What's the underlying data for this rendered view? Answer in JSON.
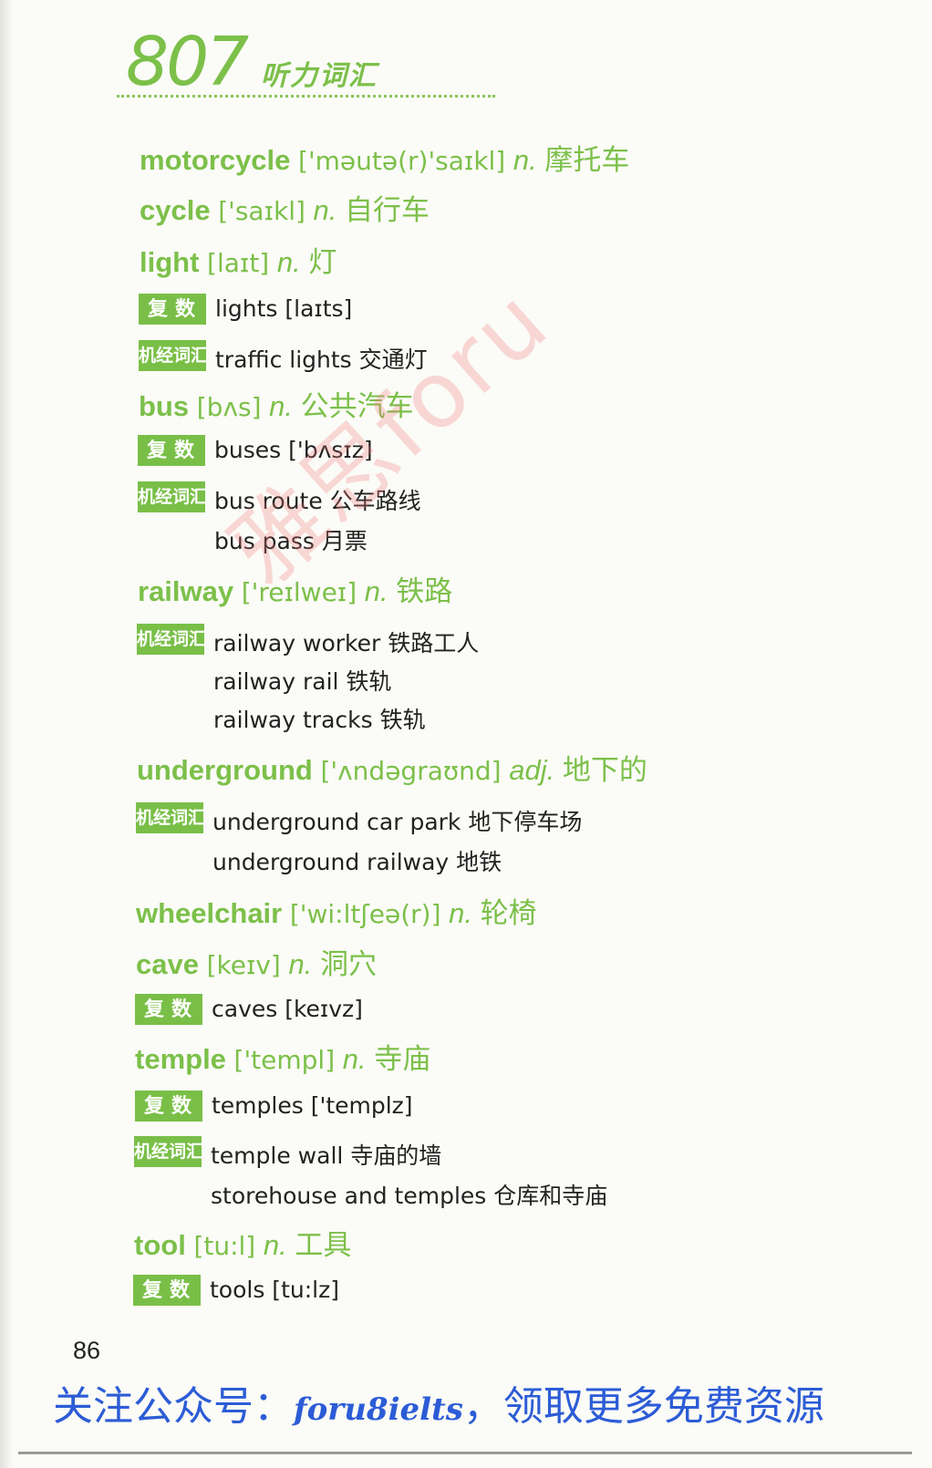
{
  "header": {
    "number": "807",
    "title": "听力词汇"
  },
  "entries": [
    {
      "kind": "head",
      "word": "motorcycle",
      "phonetic": "['məutə(r)'saɪkl]",
      "pos": "n.",
      "meaning": "摩托车"
    },
    {
      "kind": "head",
      "word": "cycle",
      "phonetic": "['saɪkl]",
      "pos": "n.",
      "meaning": "自行车"
    },
    {
      "kind": "head",
      "word": "light",
      "phonetic": "[laɪt]",
      "pos": "n.",
      "meaning": "灯"
    },
    {
      "kind": "sub",
      "tag": "复数",
      "tagType": "plural",
      "text": "lights [laɪts]"
    },
    {
      "kind": "sub",
      "tag": "机经词汇",
      "tagType": "jijing",
      "text": "traffic lights 交通灯"
    },
    {
      "kind": "head",
      "word": "bus",
      "phonetic": "[bʌs]",
      "pos": "n.",
      "meaning": "公共汽车"
    },
    {
      "kind": "sub",
      "tag": "复数",
      "tagType": "plural",
      "text": "buses ['bʌsɪz]"
    },
    {
      "kind": "sub",
      "tag": "机经词汇",
      "tagType": "jijing",
      "text": "bus route 公车路线"
    },
    {
      "kind": "sub",
      "tag": "",
      "tagType": "none",
      "text": "bus pass 月票"
    },
    {
      "kind": "head",
      "word": "railway",
      "phonetic": "['reɪlweɪ]",
      "pos": "n.",
      "meaning": "铁路"
    },
    {
      "kind": "sub",
      "tag": "机经词汇",
      "tagType": "jijing",
      "text": "railway worker 铁路工人"
    },
    {
      "kind": "sub",
      "tag": "",
      "tagType": "none",
      "text": "railway rail 铁轨"
    },
    {
      "kind": "sub",
      "tag": "",
      "tagType": "none",
      "text": "railway tracks 铁轨"
    },
    {
      "kind": "head",
      "word": "underground",
      "phonetic": "['ʌndəgraʊnd]",
      "pos": "adj.",
      "meaning": "地下的"
    },
    {
      "kind": "sub",
      "tag": "机经词汇",
      "tagType": "jijing",
      "text": "underground car park 地下停车场"
    },
    {
      "kind": "sub",
      "tag": "",
      "tagType": "none",
      "text": "underground railway 地铁"
    },
    {
      "kind": "head",
      "word": "wheelchair",
      "phonetic": "['wi:ltʃeə(r)]",
      "pos": "n.",
      "meaning": "轮椅"
    },
    {
      "kind": "head",
      "word": "cave",
      "phonetic": "[keɪv]",
      "pos": "n.",
      "meaning": "洞穴"
    },
    {
      "kind": "sub",
      "tag": "复数",
      "tagType": "plural",
      "text": "caves [keɪvz]"
    },
    {
      "kind": "head",
      "word": "temple",
      "phonetic": "['templ]",
      "pos": "n.",
      "meaning": "寺庙"
    },
    {
      "kind": "sub",
      "tag": "复数",
      "tagType": "plural",
      "text": "temples ['templz]"
    },
    {
      "kind": "sub",
      "tag": "机经词汇",
      "tagType": "jijing",
      "text": "temple wall 寺庙的墙"
    },
    {
      "kind": "sub",
      "tag": "",
      "tagType": "none",
      "text": "storehouse and temples 仓库和寺庙"
    },
    {
      "kind": "head",
      "word": "tool",
      "phonetic": "[tu:l]",
      "pos": "n.",
      "meaning": "工具"
    },
    {
      "kind": "sub",
      "tag": "复数",
      "tagType": "plural",
      "text": "tools [tu:lz]"
    }
  ],
  "watermark": "雅思foru",
  "page_number": "86",
  "footer": {
    "prefix": "关注公众号：",
    "brand": "foru8ielts",
    "suffix": "，领取更多免费资源"
  },
  "colors": {
    "accent_green": "#7cc04a",
    "tag_green": "#79bf47",
    "footer_blue": "#2c5cd6",
    "watermark_red": "#f07878"
  }
}
